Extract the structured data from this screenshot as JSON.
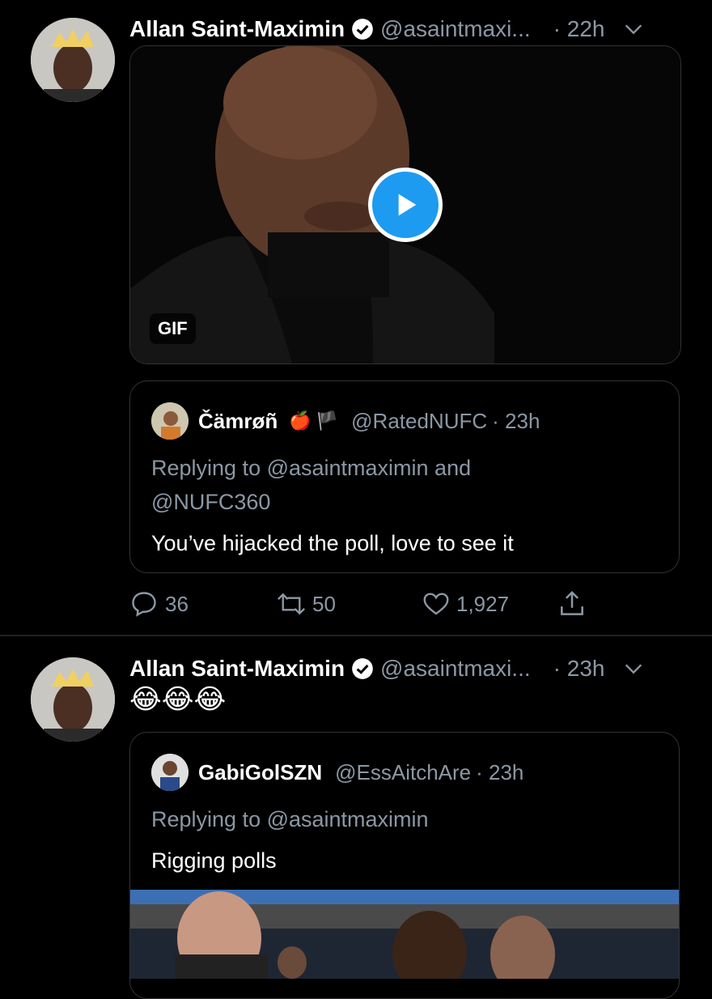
{
  "tweets": [
    {
      "name": "Allan Saint-Maximin",
      "handle": "@asaintmaxi...",
      "time": "· 22h",
      "media_badge": "GIF",
      "quote": {
        "name": "Čämrøñ",
        "flags": "🍎 🏴",
        "handle": "@RatedNUFC",
        "time": "· 23h",
        "replying": "Replying to @asaintmaximin and @NUFC360",
        "text": "You’ve hijacked the poll, love to see it"
      },
      "actions": {
        "replies": "36",
        "retweets": "50",
        "likes": "1,927"
      }
    },
    {
      "name": "Allan Saint-Maximin",
      "handle": "@asaintmaxi...",
      "time": "· 23h",
      "text": "😂😂😂",
      "quote": {
        "name": "GabiGolSZN",
        "handle": "@EssAitchAre",
        "time": "· 23h",
        "replying": "Replying to @asaintmaximin",
        "text": "Rigging polls"
      }
    }
  ],
  "icons": [
    "verified-icon",
    "chevron-down-icon",
    "play-icon",
    "reply-icon",
    "retweet-icon",
    "like-icon",
    "share-icon"
  ],
  "colors": {
    "background": "#000000",
    "muted": "#8b98a5",
    "accent": "#1d9bf0",
    "border": "#333333"
  }
}
